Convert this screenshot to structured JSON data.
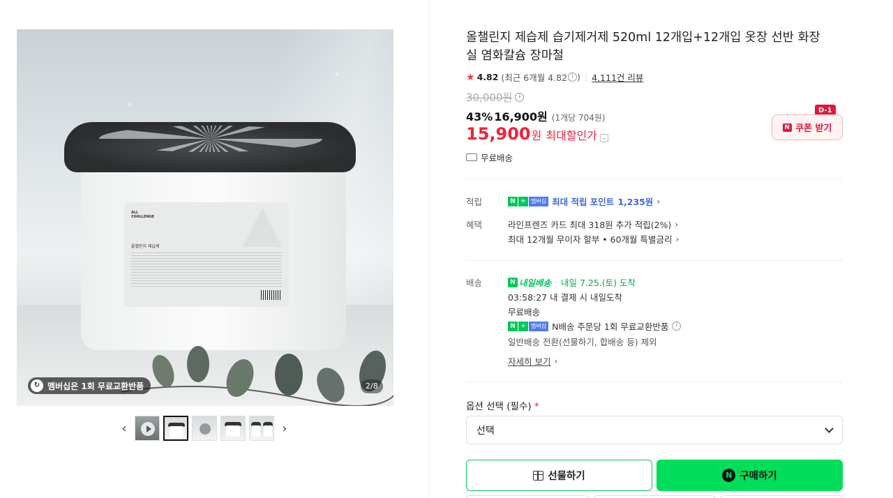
{
  "gallery": {
    "label_brand": "ALL CHALLENGE",
    "label_product": "올챌린지 제습제",
    "membership_badge": "멤버십은 1회 무료교환반품",
    "counter": "2/8",
    "prev_icon": "chevron-left-icon",
    "next_icon": "chevron-right-icon",
    "thumbnail_count": 5,
    "active_thumbnail": 2
  },
  "product": {
    "title": "올챌린지 제습제 습기제거제 520ml 12개입+12개입 옷장 선반 화장실 염화칼슘 장마철",
    "rating": "4.82",
    "rating_sub": "(최근 6개월 4.82",
    "rating_sub_close": ")",
    "review_count": "4,111건 리뷰",
    "original_price": "30,000원",
    "discount_pct": "43%",
    "discount_price": "16,900원",
    "unit_price": "(1개당 704원)",
    "max_price": "15,900",
    "max_won": "원",
    "max_label": "최대할인가",
    "coupon_label": "쿠폰 받기",
    "coupon_tag": "D-1",
    "coupon_n": "N",
    "free_shipping": "무료배송",
    "accent_color": "#f0233a",
    "npay_green": "#03c75a"
  },
  "benefits": {
    "points_label": "적립",
    "points_text": "최대 적립 포인트",
    "points_value": "1,235원",
    "benefit_label": "혜택",
    "benefit_line1": "라인프렌즈 카드 최대 318원 추가 적립(2%)",
    "benefit_line2": "최대 12개월 무이자 할부 • 60개월 특별금리"
  },
  "delivery": {
    "label": "배송",
    "tomorrow_badge": "내일배송",
    "arrival": "내일 7.25.(토) 도착",
    "countdown": "03:58:27  내 결제 시 내일도착",
    "free_shipping": "무료배송",
    "exchange_text": "N배송 주문당 1회 무료교환반품",
    "exception": "일반배송 전환(선물하기, 합배송 등) 제외",
    "detail_link": "자세히 보기",
    "membership_tag": "멤버십",
    "n_tag": "N",
    "plus_tag": "+"
  },
  "options": {
    "label": "옵션 선택 (필수)",
    "required_mark": "*",
    "selected": "선택"
  },
  "actions": {
    "gift_label": "선물하기",
    "buy_label": "구매하기",
    "buy_n": "N"
  }
}
